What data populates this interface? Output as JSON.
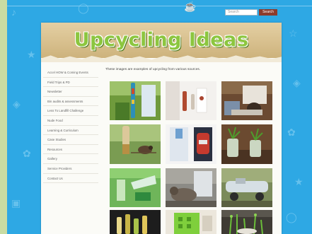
{
  "search": {
    "placeholder": "Search",
    "button_label": "Search"
  },
  "site": {
    "title": "Upcycling Ideas"
  },
  "sidebar": {
    "items": [
      {
        "label": "Accel HOW & Coming Events"
      },
      {
        "label": "Field Trips & PD"
      },
      {
        "label": "Newsletter"
      },
      {
        "label": "Bin audits & assessments"
      },
      {
        "label": "Less To Landfill Challenge"
      },
      {
        "label": "Nude Food"
      },
      {
        "label": "Learning & Curriculum"
      },
      {
        "label": "Case Studies"
      },
      {
        "label": "Resources"
      },
      {
        "label": "Gallery"
      },
      {
        "label": "Service Providers"
      },
      {
        "label": "Contact Us"
      }
    ]
  },
  "main": {
    "intro": "These images are examples of upcycling from various sources."
  },
  "gallery": {
    "images": [
      {
        "icon": "hanging-bottle-feeder-photo"
      },
      {
        "icon": "bottle-wall-hook-photo"
      },
      {
        "icon": "bottle-bird-photo"
      },
      {
        "icon": "bottle-birdfeeder-photo"
      },
      {
        "icon": "recycled-bottle-craft-photo"
      },
      {
        "icon": "bottle-planter-photo"
      },
      {
        "icon": "bottle-garden-tool-photo"
      },
      {
        "icon": "cat-feeder-photo"
      },
      {
        "icon": "bottle-toy-car-photo"
      },
      {
        "icon": "bottle-display-photo"
      },
      {
        "icon": "green-crate-photo"
      },
      {
        "icon": "bottle-seedlings-photo"
      }
    ]
  },
  "colors": {
    "sky": "#2ea8e4",
    "logo_green": "#8cc63f",
    "search_button": "#8c3b2c",
    "banner": "#d8c08e"
  }
}
